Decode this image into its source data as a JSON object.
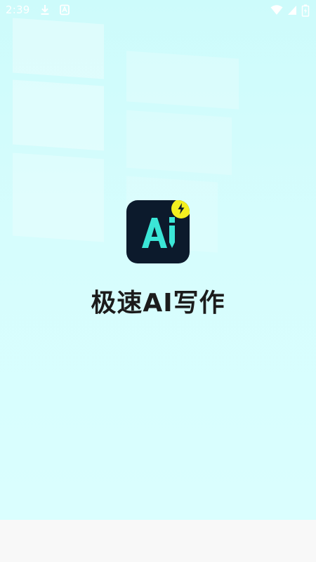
{
  "status_bar": {
    "time": "2:39",
    "icons": [
      "download-icon",
      "app-notification-icon",
      "wifi-icon",
      "signal-icon",
      "battery-icon"
    ]
  },
  "splash": {
    "logo_text": "Ai",
    "app_name": "极速AI写作"
  },
  "colors": {
    "background": "#d6fdfd",
    "logo_bg": "#0c1a2c",
    "logo_accent": "#3be6d7",
    "badge": "#f3ef1f",
    "title": "#1c1c1c",
    "nav_bar": "#f8f8f8"
  }
}
